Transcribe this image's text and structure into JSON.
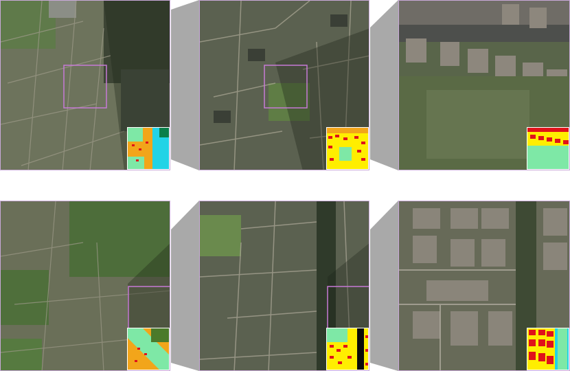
{
  "figure": {
    "rows": [
      {
        "name": "row-1",
        "panels": [
          {
            "name": "aerial-overview",
            "level": "zoom-1"
          },
          {
            "name": "aerial-mid-zoom",
            "level": "zoom-2"
          },
          {
            "name": "aerial-close-zoom",
            "level": "zoom-3"
          }
        ]
      },
      {
        "name": "row-2",
        "panels": [
          {
            "name": "aerial-overview",
            "level": "zoom-1"
          },
          {
            "name": "aerial-mid-zoom",
            "level": "zoom-2"
          },
          {
            "name": "aerial-close-zoom",
            "level": "zoom-3"
          }
        ]
      }
    ],
    "colors": {
      "zoom_box": "#c77ad6",
      "connector": "#8a8a8a",
      "seg_residential": "#f2a51a",
      "seg_building": "#e0121a",
      "seg_greenspace": "#7ee8a6",
      "seg_water": "#22d3e6",
      "seg_road": "#ffee00",
      "seg_other": "#0a0a0a"
    }
  }
}
